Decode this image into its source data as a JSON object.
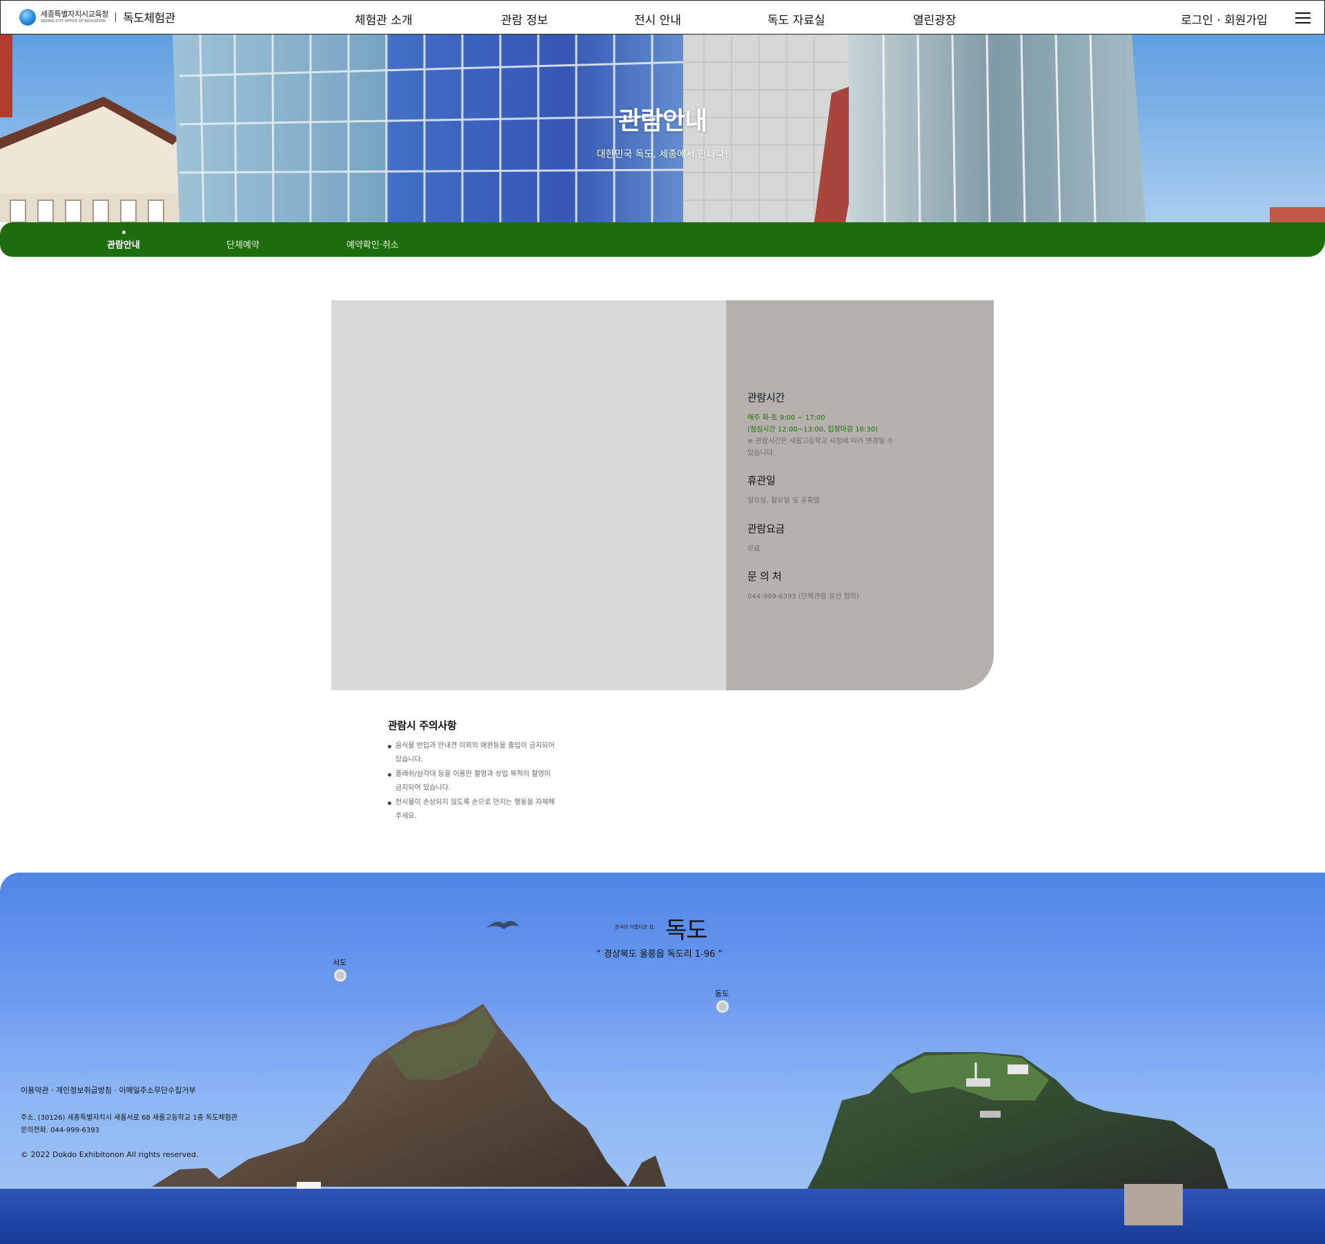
{
  "header": {
    "logo_org_ko": "세종특별자치시교육청",
    "logo_org_en": "SEJONG CITY OFFICE OF EDUCATION",
    "site_title": "독도체험관",
    "nav": [
      "체험관 소개",
      "관람 정보",
      "전시 안내",
      "독도 자료실",
      "열린광장"
    ],
    "login_label": "로그인 · 회원가입",
    "menu_icon": "hamburger-menu-icon"
  },
  "hero": {
    "title": "관람안내",
    "subtitle": "대한민국 독도, 세종에서 만나다!"
  },
  "subnav": {
    "items": [
      "관람안내",
      "단체예약",
      "예약확인·취소"
    ],
    "active": "관람안내"
  },
  "info": {
    "hours": {
      "heading": "관람시간",
      "line1": "매주 화-토 9:00 ~ 17:00",
      "line2": "(점심시간 12:00~13:00, 입장마감 16:30)",
      "note1": "※ 관람시간은 새롬고등학교 사정에 따라 변경될 수",
      "note2": "있습니다."
    },
    "closed": {
      "heading": "휴관일",
      "text": "일요일, 월요일 및 공휴일"
    },
    "fee": {
      "heading": "관람요금",
      "text": "무료"
    },
    "contact": {
      "heading": "문 의 처",
      "text": "044-999-6393 (단체관람 유선 협의)"
    }
  },
  "notice": {
    "heading": "관람시 주의사항",
    "items": [
      [
        "음식물 반입과 안내견 이외의 애완동물 출입이 금지되어",
        "있습니다."
      ],
      [
        "플래쉬/삼각대 등을 이용한 촬영과 상업 목적의 촬영이",
        "금지되어 있습니다."
      ],
      [
        "전시물이 손상되지 않도록 손으로 만지는 행동을 자제해",
        "주세요."
      ]
    ]
  },
  "dokdo": {
    "tagline": "한국의 아름다운 섬,",
    "title": "독도",
    "address": "“ 경상북도 울릉읍 독도리 1-96 ”",
    "west_label": "서도",
    "east_label": "동도"
  },
  "footer": {
    "links": "이용약관 · 개인정보취급방침 · 이메일주소무단수집거부",
    "address": "주소. (30126) 세종특별자치시 새롬서로 68 새롬고등학교 1층 독도체험관",
    "phone": "문의전화. 044-999-6393",
    "copyright": "© 2022 Dokdo Exhibitonon All rights reserved."
  },
  "colors": {
    "brand_green": "#1d6d0c",
    "card_gray": "#d9d9d9",
    "card_taupe": "#b6b1ad",
    "top_button": "#b4a69b"
  }
}
